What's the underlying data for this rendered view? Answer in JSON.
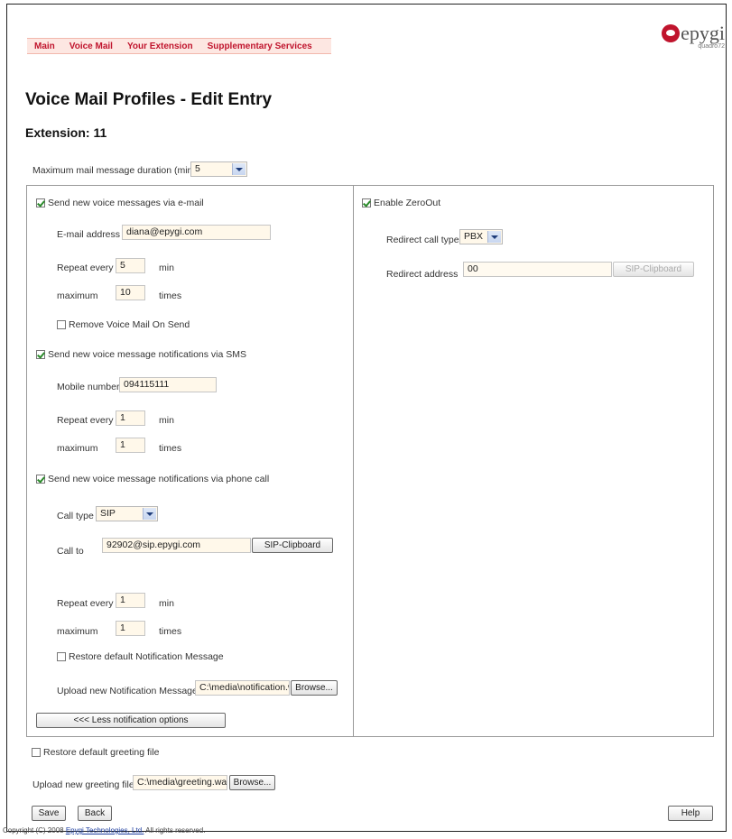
{
  "nav": {
    "items": [
      "Main",
      "Voice Mail",
      "Your Extension",
      "Supplementary Services"
    ]
  },
  "logo": {
    "word": "epygi",
    "sub": "quadro72"
  },
  "page": {
    "title": "Voice Mail Profiles - Edit Entry",
    "extension": "Extension: 11"
  },
  "max_duration": {
    "label": "Maximum mail message duration (min)",
    "value": "5"
  },
  "email": {
    "checkbox_label": "Send new voice messages via e-mail",
    "checked": true,
    "address_label": "E-mail address",
    "address_value": "diana@epygi.com",
    "repeat_label": "Repeat every",
    "repeat_value": "5",
    "repeat_unit": "min",
    "max_label": "maximum",
    "max_value": "10",
    "max_unit": "times",
    "remove_label": "Remove Voice Mail On Send"
  },
  "sms": {
    "checkbox_label": "Send new voice message notifications via SMS",
    "checked": true,
    "mobile_label": "Mobile number",
    "mobile_value": "094115111",
    "repeat_label": "Repeat every",
    "repeat_value": "1",
    "repeat_unit": "min",
    "max_label": "maximum",
    "max_value": "1",
    "max_unit": "times"
  },
  "phone": {
    "checkbox_label": "Send new voice message notifications via phone call",
    "checked": true,
    "call_type_label": "Call type",
    "call_type_value": "SIP",
    "call_to_label": "Call to",
    "call_to_value": "92902@sip.epygi.com",
    "clipboard_button": "SIP-Clipboard",
    "repeat_label": "Repeat every",
    "repeat_value": "1",
    "repeat_unit": "min",
    "max_label": "maximum",
    "max_value": "1",
    "max_unit": "times",
    "restore_label": "Restore default Notification Message",
    "upload_label": "Upload new Notification Message",
    "upload_value": "C:\\media\\notification.wav",
    "browse_button": "Browse...",
    "less_button": "<<< Less notification options"
  },
  "zeroout": {
    "checkbox_label": "Enable ZeroOut",
    "checked": true,
    "redirect_type_label": "Redirect call type",
    "redirect_type_value": "PBX",
    "redirect_address_label": "Redirect address",
    "redirect_address_value": "00",
    "clipboard_button": "SIP-Clipboard"
  },
  "greeting": {
    "restore_label": "Restore default greeting file",
    "upload_label": "Upload new greeting file",
    "upload_value": "C:\\media\\greeting.wav",
    "browse_button": "Browse..."
  },
  "actions": {
    "save": "Save",
    "back": "Back",
    "help": "Help"
  },
  "footer": {
    "copyright_prefix": "Copyright (C) 2008 ",
    "company": "Epygi Technologies, Ltd.",
    "copyright_suffix": " All rights reserved."
  }
}
